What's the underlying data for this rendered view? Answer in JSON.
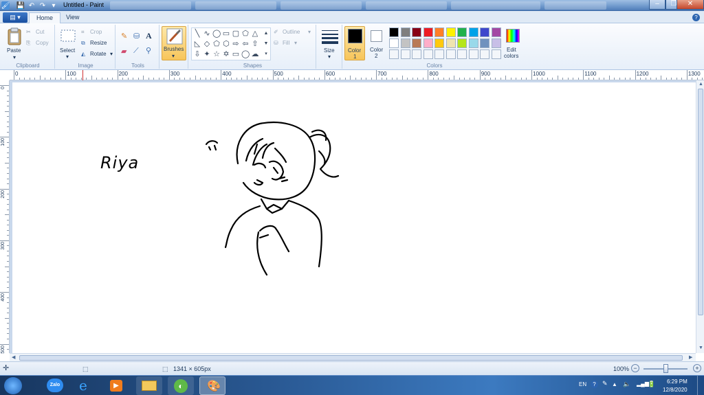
{
  "window": {
    "title": "Untitled - Paint",
    "controls": {
      "minimize": "–",
      "maximize": "❐",
      "close": "✕"
    }
  },
  "ribbon": {
    "file_button": "▤ ▾",
    "tabs": [
      {
        "label": "Home"
      },
      {
        "label": "View"
      }
    ],
    "clipboard": {
      "paste": "Paste",
      "cut": "Cut",
      "copy": "Copy",
      "group": "Clipboard"
    },
    "image": {
      "select": "Select",
      "crop": "Crop",
      "resize": "Resize",
      "rotate": "Rotate",
      "group": "Image"
    },
    "tools": {
      "group": "Tools",
      "text_tool": "A"
    },
    "brushes": {
      "label": "Brushes"
    },
    "shapes": {
      "outline": "Outline",
      "fill": "Fill",
      "group": "Shapes"
    },
    "size": {
      "label": "Size"
    },
    "color1": {
      "label": "Color",
      "num": "1",
      "value": "#000000"
    },
    "color2": {
      "label": "Color",
      "num": "2",
      "value": "#ffffff"
    },
    "colors_group": "Colors",
    "edit_colors": {
      "line1": "Edit",
      "line2": "colors"
    },
    "palette_row1": [
      "#000000",
      "#7f7f7f",
      "#880015",
      "#ed1c24",
      "#ff7f27",
      "#fff200",
      "#22b14c",
      "#00a2e8",
      "#3f48cc",
      "#a349a4"
    ],
    "palette_row2": [
      "#ffffff",
      "#c3c3c3",
      "#b97a57",
      "#ffaec9",
      "#ffc90e",
      "#efe4b0",
      "#b5e61d",
      "#99d9ea",
      "#7092be",
      "#c8bfe7"
    ]
  },
  "ruler": {
    "h_ticks": [
      "0",
      "100",
      "200",
      "300",
      "400",
      "500",
      "600",
      "700",
      "800",
      "900",
      "1000",
      "1100",
      "1200",
      "1300"
    ],
    "v_ticks": [
      "0",
      "100",
      "200",
      "300",
      "400",
      "500"
    ]
  },
  "canvas": {
    "handwritten_text": "Riya"
  },
  "status": {
    "image_size": "1341 × 605px",
    "zoom": "100%"
  },
  "taskbar": {
    "zalo_label": "Zalo",
    "language": "EN",
    "time": "6:29 PM",
    "date": "12/8/2020"
  }
}
